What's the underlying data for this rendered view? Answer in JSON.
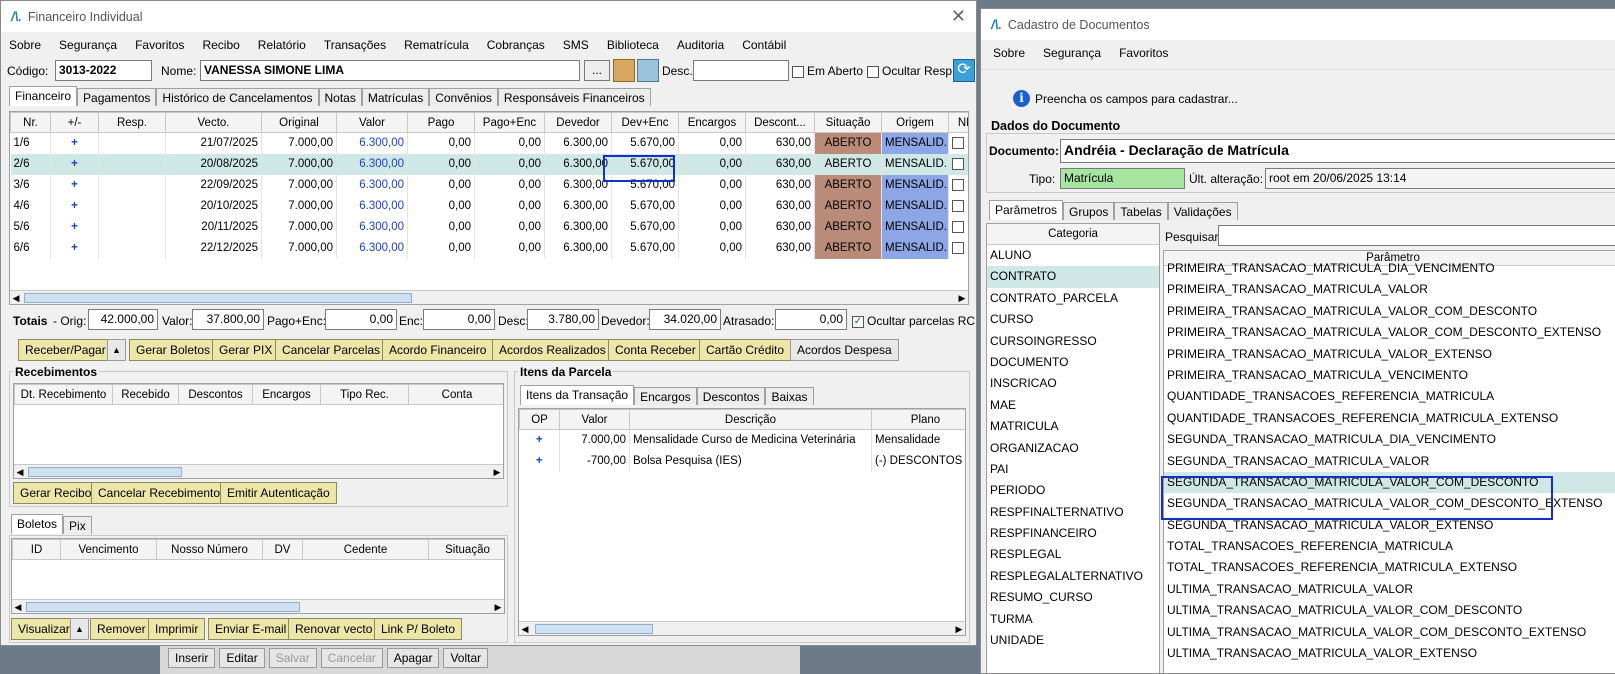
{
  "left": {
    "title": "Financeiro Individual",
    "menu": [
      "Sobre",
      "Segurança",
      "Favoritos",
      "Recibo",
      "Relatório",
      "Transações",
      "Rematrícula",
      "Cobranças",
      "SMS",
      "Biblioteca",
      "Auditoria",
      "Contábil"
    ],
    "codigo_label": "Código:",
    "codigo": "3013-2022",
    "nome_label": "Nome:",
    "nome": "VANESSA SIMONE LIMA",
    "ellipsis": "...",
    "desc_label": "Desc.:",
    "em_aberto": "Em Aberto",
    "ocultar_resp": "Ocultar Resp.",
    "tabs": [
      "Financeiro",
      "Pagamentos",
      "Histórico de Cancelamentos",
      "Notas",
      "Matrículas",
      "Convênios",
      "Responsáveis Financeiros"
    ],
    "grid_headers": [
      "Nr.",
      "+/-",
      "Resp.",
      "Vecto.",
      "Original",
      "Valor",
      "Pago",
      "Pago+Enc",
      "Devedor",
      "Dev+Enc",
      "Encargos",
      "Descont...",
      "Situação",
      "Origem",
      "NF"
    ],
    "rows": [
      [
        "1/6",
        "+",
        "",
        "21/07/2025",
        "7.000,00",
        "6.300,00",
        "0,00",
        "0,00",
        "6.300,00",
        "5.670,00",
        "0,00",
        "630,00",
        "ABERTO",
        "MENSALID..."
      ],
      [
        "2/6",
        "+",
        "",
        "20/08/2025",
        "7.000,00",
        "6.300,00",
        "0,00",
        "0,00",
        "6.300,00",
        "5.670,00",
        "0,00",
        "630,00",
        "ABERTO",
        "MENSALID..."
      ],
      [
        "3/6",
        "+",
        "",
        "22/09/2025",
        "7.000,00",
        "6.300,00",
        "0,00",
        "0,00",
        "6.300,00",
        "5.670,00",
        "0,00",
        "630,00",
        "ABERTO",
        "MENSALID..."
      ],
      [
        "4/6",
        "+",
        "",
        "20/10/2025",
        "7.000,00",
        "6.300,00",
        "0,00",
        "0,00",
        "6.300,00",
        "5.670,00",
        "0,00",
        "630,00",
        "ABERTO",
        "MENSALID..."
      ],
      [
        "5/6",
        "+",
        "",
        "20/11/2025",
        "7.000,00",
        "6.300,00",
        "0,00",
        "0,00",
        "6.300,00",
        "5.670,00",
        "0,00",
        "630,00",
        "ABERTO",
        "MENSALID..."
      ],
      [
        "6/6",
        "+",
        "",
        "22/12/2025",
        "7.000,00",
        "6.300,00",
        "0,00",
        "0,00",
        "6.300,00",
        "5.670,00",
        "0,00",
        "630,00",
        "ABERTO",
        "MENSALID..."
      ]
    ],
    "totais": {
      "label": "Totais",
      "orig_label": "- Orig:",
      "orig": "42.000,00",
      "valor_label": "Valor:",
      "valor": "37.800,00",
      "pagoenc_label": "Pago+Enc:",
      "pagoenc": "0,00",
      "enc_label": "Enc:",
      "enc": "0,00",
      "desc_label": "Desc:",
      "desc": "3.780,00",
      "devedor_label": "Devedor:",
      "devedor": "34.020,00",
      "atrasado_label": "Atrasado:",
      "atrasado": "0,00",
      "ocultar": "Ocultar parcelas RC"
    },
    "buttons": [
      "Receber/Pagar",
      "Gerar Boletos",
      "Gerar PIX",
      "Cancelar Parcelas",
      "Acordo Financeiro",
      "Acordos Realizados",
      "Conta Receber",
      "Cartão Crédito",
      "Acordos Despesa"
    ],
    "recebimentos": {
      "title": "Recebimentos",
      "headers": [
        "Dt. Recebimento",
        "Recebido",
        "Descontos",
        "Encargos",
        "Tipo Rec.",
        "Conta"
      ],
      "buttons": [
        "Gerar Recibo",
        "Cancelar Recebimento",
        "Emitir Autenticação"
      ]
    },
    "itens": {
      "title": "Itens da Parcela",
      "tabs": [
        "Itens da Transação",
        "Encargos",
        "Descontos",
        "Baixas"
      ],
      "headers": [
        "OP",
        "Valor",
        "Descrição",
        "Plano"
      ],
      "rows": [
        [
          "+",
          "7.000,00",
          "Mensalidade Curso de Medicina Veterinária",
          "Mensalidade"
        ],
        [
          "+",
          "-700,00",
          "Bolsa Pesquisa (IES)",
          "(-) DESCONTOS D"
        ]
      ]
    },
    "boletos": {
      "tabs": [
        "Boletos",
        "Pix"
      ],
      "headers": [
        "ID",
        "Vencimento",
        "Nosso Número",
        "DV",
        "Cedente",
        "Situação"
      ],
      "buttons": [
        "Visualizar",
        "Remover",
        "Imprimir",
        "Enviar E-mail",
        "Renovar vecto",
        "Link P/ Boleto"
      ]
    },
    "bottom_buttons": [
      "Inserir",
      "Editar",
      "Salvar",
      "Cancelar",
      "Apagar",
      "Voltar"
    ]
  },
  "right": {
    "title": "Cadastro de Documentos",
    "menu": [
      "Sobre",
      "Segurança",
      "Favoritos"
    ],
    "info": "Preencha os campos para cadastrar...",
    "group_title": "Dados do Documento",
    "documento_label": "Documento:",
    "documento": "Andréia - Declaração de Matrícula",
    "tipo_label": "Tipo:",
    "tipo": "Matrícula",
    "ult_label": "Últ. alteração:",
    "ult": "root em 20/06/2025 13:14",
    "tabs": [
      "Parâmetros",
      "Grupos",
      "Tabelas",
      "Validações"
    ],
    "categoria_header": "Categoria",
    "categorias": [
      "ALUNO",
      "CONTRATO",
      "CONTRATO_PARCELA",
      "CURSO",
      "CURSOINGRESSO",
      "DOCUMENTO",
      "INSCRICAO",
      "MAE",
      "MATRICULA",
      "ORGANIZACAO",
      "PAI",
      "PERIODO",
      "RESPFINALTERNATIVO",
      "RESPFINANCEIRO",
      "RESPLEGAL",
      "RESPLEGALALTERNATIVO",
      "RESUMO_CURSO",
      "TURMA",
      "UNIDADE"
    ],
    "pesquisar_label": "Pesquisar:",
    "parametro_header": "Parâmetro",
    "parametros": [
      "PRIMEIRA_TRANSACAO_MATRICULA_DIA_VENCIMENTO",
      "PRIMEIRA_TRANSACAO_MATRICULA_VALOR",
      "PRIMEIRA_TRANSACAO_MATRICULA_VALOR_COM_DESCONTO",
      "PRIMEIRA_TRANSACAO_MATRICULA_VALOR_COM_DESCONTO_EXTENSO",
      "PRIMEIRA_TRANSACAO_MATRICULA_VALOR_EXTENSO",
      "PRIMEIRA_TRANSACAO_MATRICULA_VENCIMENTO",
      "QUANTIDADE_TRANSACOES_REFERENCIA_MATRICULA",
      "QUANTIDADE_TRANSACOES_REFERENCIA_MATRICULA_EXTENSO",
      "SEGUNDA_TRANSACAO_MATRICULA_DIA_VENCIMENTO",
      "SEGUNDA_TRANSACAO_MATRICULA_VALOR",
      "SEGUNDA_TRANSACAO_MATRICULA_VALOR_COM_DESCONTO",
      "SEGUNDA_TRANSACAO_MATRICULA_VALOR_COM_DESCONTO_EXTENSO",
      "SEGUNDA_TRANSACAO_MATRICULA_VALOR_EXTENSO",
      "TOTAL_TRANSACOES_REFERENCIA_MATRICULA",
      "TOTAL_TRANSACOES_REFERENCIA_MATRICULA_EXTENSO",
      "ULTIMA_TRANSACAO_MATRICULA_VALOR",
      "ULTIMA_TRANSACAO_MATRICULA_VALOR_COM_DESCONTO",
      "ULTIMA_TRANSACAO_MATRICULA_VALOR_COM_DESCONTO_EXTENSO",
      "ULTIMA_TRANSACAO_MATRICULA_VALOR_EXTENSO"
    ]
  }
}
